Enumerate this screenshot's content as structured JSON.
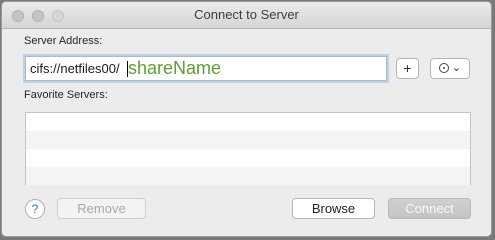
{
  "window": {
    "title": "Connect to Server"
  },
  "server_address": {
    "label": "Server Address:",
    "value_base": "cifs://netfiles00/",
    "value_placeholder_part": "shareName",
    "add_label": "+",
    "history_arrow": "⌄"
  },
  "favorites": {
    "label": "Favorite Servers:"
  },
  "buttons": {
    "help_label": "?",
    "remove_label": "Remove",
    "browse_label": "Browse",
    "connect_label": "Connect"
  },
  "colors": {
    "placeholder_green": "#5f9e33",
    "help_blue": "#2f6fd3"
  }
}
